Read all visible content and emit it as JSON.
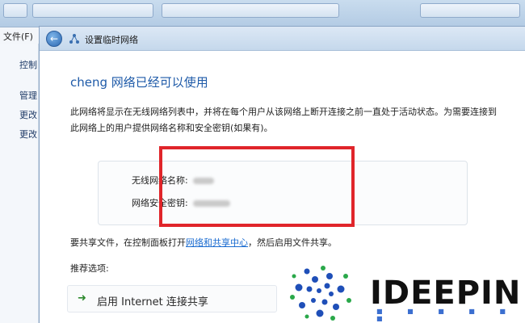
{
  "background": {
    "menu_file": "文件(F)",
    "sidebar": [
      "控制",
      "管理",
      "更改",
      "更改"
    ]
  },
  "dialog": {
    "title": "设置临时网络",
    "heading": "cheng 网络已经可以使用",
    "description": "此网络将显示在无线网络列表中，并将在每个用户从该网络上断开连接之前一直处于活动状态。为需要连接到此网络上的用户提供网络名称和安全密钥(如果有)。",
    "network_name_label": "无线网络名称:",
    "security_key_label": "网络安全密钥:",
    "share_prefix": "要共享文件，在控制面板打开",
    "share_link": "网络和共享中心",
    "share_suffix": "，然后启用文件共享。",
    "recommended_label": "推荐选项:",
    "option_ics": "启用 Internet 连接共享"
  },
  "watermark": {
    "brand": "IDEEPIN"
  },
  "colors": {
    "accent": "#1e5aa8",
    "highlight_box": "#e0252a",
    "link": "#1a6bd0"
  },
  "icons": [
    "back-arrow-icon",
    "network-icon",
    "green-arrow-icon"
  ]
}
